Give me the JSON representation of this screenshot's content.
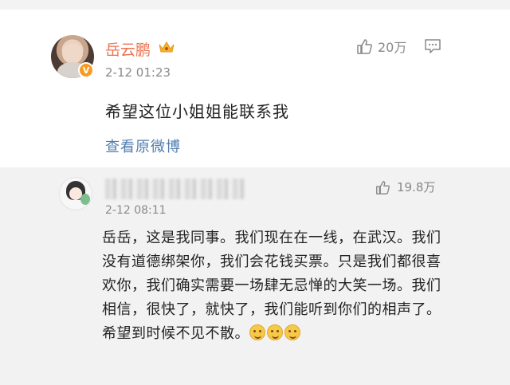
{
  "main_comment": {
    "username": "岳云鹏",
    "vip_badge": "V",
    "time": "2-12 01:23",
    "likes": "20万",
    "text": "希望这位小姐姐能联系我",
    "view_original_label": "查看原微博"
  },
  "reply_comment": {
    "time": "2-12 08:11",
    "likes": "19.8万",
    "text": "岳岳，这是我同事。我们现在在一线，在武汉。我们没有道德绑架你，我们会花钱买票。只是我们都很喜欢你，我们确实需要一场肆无忌惮的大笑一场。我们相信，很快了，就快了，我们能听到你们的相声了。希望到时候不见不散。",
    "emoji_count": 3
  },
  "colors": {
    "username": "#eb7350",
    "link": "#507daf",
    "muted": "#8a8a8a",
    "reply_bg": "#f2f2f2"
  },
  "icons": {
    "like": "thumbs-up-icon",
    "reply": "comment-icon",
    "crown": "crown-icon"
  }
}
